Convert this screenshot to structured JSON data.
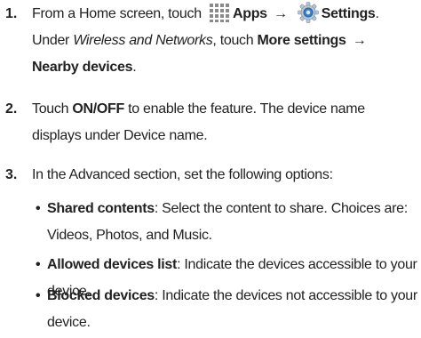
{
  "steps": [
    {
      "num": "1.",
      "from": "From a Home screen, touch",
      "apps": "Apps",
      "arrow1": "→",
      "settings": "Settings",
      "period1": ".",
      "under": "Under",
      "wireless": "Wireless and Networks",
      "comma_touch": ", touch",
      "more_settings": "More settings",
      "arrow2": "→",
      "nearby": "Nearby devices",
      "period2": ".",
      "icons": [
        "apps-grid-icon",
        "settings-gear-icon"
      ]
    },
    {
      "num": "2.",
      "touch": "Touch",
      "onoff": "ON/OFF",
      "rest": "to enable the feature. The device name displays under Device name."
    },
    {
      "num": "3.",
      "text": "In the Advanced section, set the following options:"
    }
  ],
  "options": [
    {
      "label": "Shared contents",
      "desc": ": Select the content to share. Choices are: Videos, Photos, and Music."
    },
    {
      "label": "Allowed devices list",
      "desc": ": Indicate the devices accessible to your device."
    },
    {
      "label": "Blocked devices",
      "desc": ": Indicate the devices not accessible to your device."
    }
  ],
  "bullet_char": "•",
  "colors": {
    "text": "#222222",
    "icon_gray": "#8a8a8a",
    "gear_blue": "#2f78c4"
  }
}
